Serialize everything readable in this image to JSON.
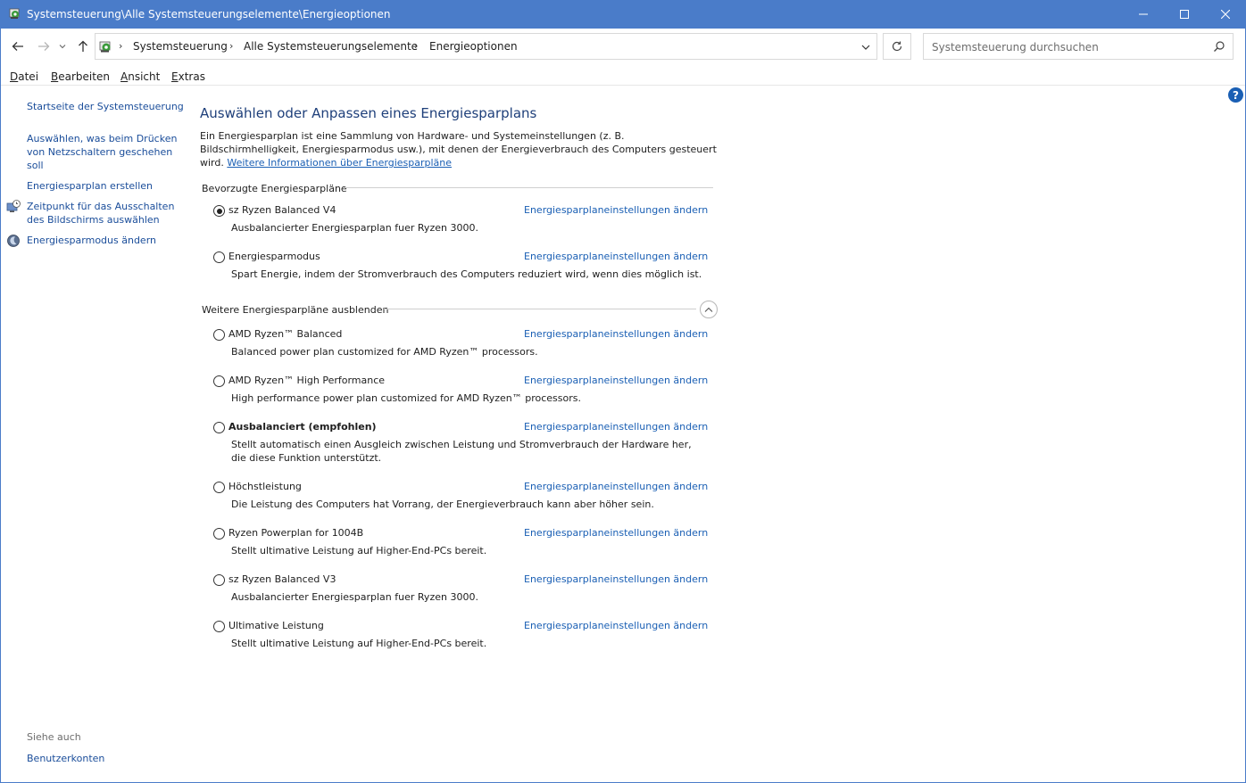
{
  "window": {
    "title": "Systemsteuerung\\Alle Systemsteuerungselemente\\Energieoptionen"
  },
  "address": {
    "crumbs": [
      "Systemsteuerung",
      "Alle Systemsteuerungselemente",
      "Energieoptionen"
    ]
  },
  "search": {
    "placeholder": "Systemsteuerung durchsuchen"
  },
  "menu": {
    "datei": {
      "u": "D",
      "rest": "atei"
    },
    "bearbeiten": {
      "u": "B",
      "rest": "earbeiten"
    },
    "ansicht": {
      "u": "A",
      "rest": "nsicht"
    },
    "extras": {
      "u": "E",
      "rest": "xtras"
    }
  },
  "sidebar": {
    "home": "Startseite der Systemsteuerung",
    "links": [
      "Auswählen, was beim Drücken von Netzschaltern geschehen soll",
      "Energiesparplan erstellen",
      "Zeitpunkt für das Ausschalten des Bildschirms auswählen",
      "Energiesparmodus ändern"
    ],
    "see_also": "Siehe auch",
    "user_accounts": "Benutzerkonten"
  },
  "main": {
    "title": "Auswählen oder Anpassen eines Energiesparplans",
    "intro": "Ein Energiesparplan ist eine Sammlung von Hardware- und Systemeinstellungen (z. B. Bildschirmhelligkeit, Energiesparmodus usw.), mit denen der Energieverbrauch des Computers gesteuert wird. ",
    "intro_link": "Weitere Informationen über Energiesparpläne",
    "preferred_header": "Bevorzugte Energiesparpläne",
    "more_header": "Weitere Energiesparpläne ausblenden",
    "change_link": "Energiesparplaneinstellungen ändern"
  },
  "preferred_plans": [
    {
      "name": "sz Ryzen Balanced V4",
      "desc": "Ausbalancierter Energiesparplan fuer Ryzen 3000.",
      "selected": true
    },
    {
      "name": "Energiesparmodus",
      "desc": "Spart Energie, indem der Stromverbrauch des Computers reduziert wird, wenn dies möglich ist.",
      "selected": false
    }
  ],
  "more_plans": [
    {
      "name": "AMD Ryzen™ Balanced",
      "desc": "Balanced power plan customized for AMD Ryzen™ processors."
    },
    {
      "name": "AMD Ryzen™ High Performance",
      "desc": "High performance power plan customized for AMD Ryzen™ processors."
    },
    {
      "name": "Ausbalanciert (empfohlen)",
      "desc": "Stellt automatisch einen Ausgleich zwischen Leistung und Stromverbrauch der Hardware her, die diese Funktion unterstützt."
    },
    {
      "name": "Höchstleistung",
      "desc": "Die Leistung des Computers hat Vorrang, der Energieverbrauch kann aber höher sein."
    },
    {
      "name": "Ryzen Powerplan for 1004B",
      "desc": "Stellt ultimative Leistung auf Higher-End-PCs bereit."
    },
    {
      "name": "sz Ryzen Balanced V3",
      "desc": "Ausbalancierter Energiesparplan fuer Ryzen 3000."
    },
    {
      "name": "Ultimative Leistung",
      "desc": "Stellt ultimative Leistung auf Higher-End-PCs bereit."
    }
  ]
}
